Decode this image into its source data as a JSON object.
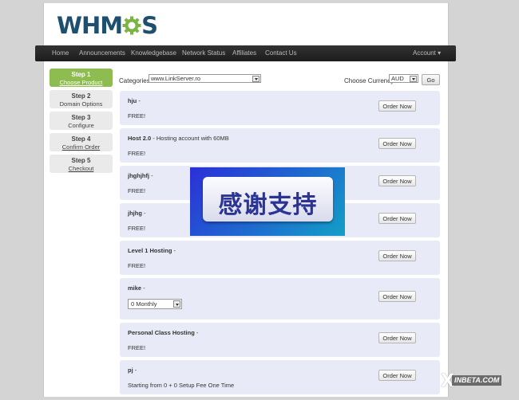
{
  "brand": {
    "logo_left": "WHM",
    "logo_right": "S",
    "logo_color": "#1d4f6e",
    "gear_color": "#7cb342"
  },
  "nav": {
    "items": [
      "Home",
      "Announcements",
      "Knowledgebase",
      "Network Status",
      "Affiliates",
      "Contact Us"
    ],
    "account": "Account"
  },
  "steps": [
    {
      "title": "Step 1",
      "label": "Choose Product"
    },
    {
      "title": "Step 2",
      "label": "Domain Options"
    },
    {
      "title": "Step 3",
      "label": "Configure"
    },
    {
      "title": "Step 4",
      "label": "Confirm Order"
    },
    {
      "title": "Step 5",
      "label": "Checkout"
    }
  ],
  "toolbar": {
    "categories_label": "Categories:",
    "category_value": "www.LinkServer.ro",
    "currency_label": "Choose Currency:",
    "currency_value": "AUD",
    "go_label": "Go"
  },
  "order_button_label": "Order Now",
  "products": [
    {
      "name": "hju",
      "desc": "",
      "price": "FREE!"
    },
    {
      "name": "Host 2.0",
      "desc": "Hosting account with 60MB",
      "price": "FREE!"
    },
    {
      "name": "jhghjhfj",
      "desc": "",
      "price": "FREE!"
    },
    {
      "name": "jhjhg",
      "desc": "",
      "price": "FREE!"
    },
    {
      "name": "Level 1 Hosting",
      "desc": "",
      "price": "FREE!"
    },
    {
      "name": "mike",
      "desc": "",
      "price": "",
      "cycle": "0 Monthly"
    },
    {
      "name": "Personal Class Hosting",
      "desc": "",
      "price": "FREE!"
    },
    {
      "name": "pj",
      "desc": "",
      "price": "Starting from 0 + 0 Setup Fee One Time"
    }
  ],
  "overlay": {
    "text": "感谢支持"
  },
  "watermark": {
    "mark": "X",
    "text": "INBETA.COM"
  }
}
